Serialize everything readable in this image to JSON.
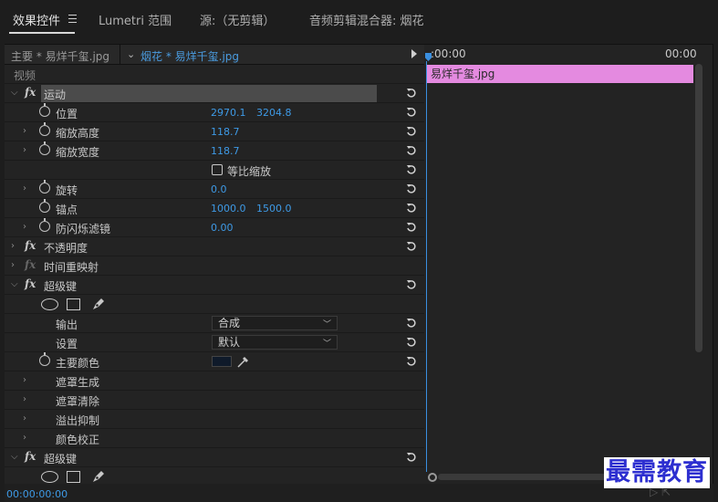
{
  "tabs": [
    {
      "label": "效果控件"
    },
    {
      "label": "Lumetri 范围"
    },
    {
      "label": "源:（无剪辑）"
    },
    {
      "label": "音频剪辑混合器: 烟花"
    }
  ],
  "clip_header": {
    "master": "主要 * 易烊千玺.jpg",
    "active_clip": "烟花 * 易烊千玺.jpg"
  },
  "timeline": {
    "start": ":00:00",
    "end": "00:00",
    "clip_label": "易烊千玺.jpg",
    "clip_color": "#e48ae0",
    "playhead_color": "#3a8fe0"
  },
  "effects": {
    "video_header": "视频",
    "motion": {
      "name": "运动",
      "position": {
        "label": "位置",
        "x": "2970.1",
        "y": "3204.8"
      },
      "scale_height": {
        "label": "缩放高度",
        "value": "118.7"
      },
      "scale_width": {
        "label": "缩放宽度",
        "value": "118.7"
      },
      "uniform_scale": {
        "label": "等比缩放",
        "checked": false
      },
      "rotation": {
        "label": "旋转",
        "value": "0.0"
      },
      "anchor": {
        "label": "锚点",
        "x": "1000.0",
        "y": "1500.0"
      },
      "anti_flicker": {
        "label": "防闪烁滤镜",
        "value": "0.00"
      }
    },
    "opacity": {
      "name": "不透明度"
    },
    "time_remap": {
      "name": "时间重映射"
    },
    "ultra_key_1": {
      "name": "超级键",
      "output": {
        "label": "输出",
        "value": "合成"
      },
      "setting": {
        "label": "设置",
        "value": "默认"
      },
      "key_color": {
        "label": "主要颜色",
        "color": "#0f1a2a"
      },
      "matte_generation": "遮罩生成",
      "matte_cleanup": "遮罩清除",
      "spill_suppression": "溢出抑制",
      "color_correction": "颜色校正"
    },
    "ultra_key_2": {
      "name": "超级键"
    }
  },
  "status": {
    "timecode": "00:00:00:00"
  },
  "watermark": "最需教育",
  "accent_color": "#3e9ae6"
}
